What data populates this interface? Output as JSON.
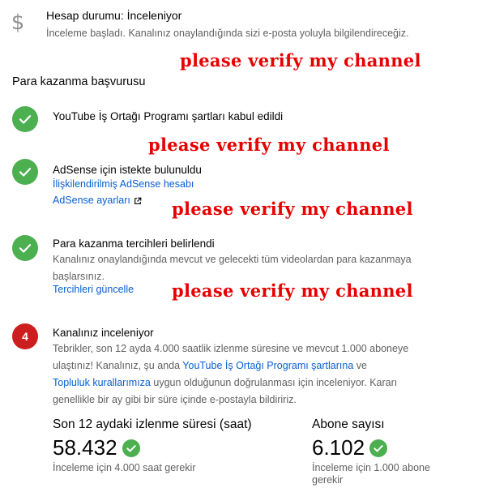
{
  "status": {
    "icon": "dollar-icon",
    "title": "Hesap durumu: İnceleniyor",
    "subtitle": "İnceleme başladı. Kanalınız onaylandığında sizi e-posta yoluyla bilgilendireceğiz."
  },
  "annotations": {
    "text": "please verify my channel",
    "color": "#e60000"
  },
  "section": {
    "title": "Para kazanma başvurusu"
  },
  "steps": [
    {
      "state": "done",
      "icon": "check-circle-icon",
      "title": "YouTube İş Ortağı Programı şartları kabul edildi"
    },
    {
      "state": "done",
      "icon": "check-circle-icon",
      "title": "AdSense için istekte bulunuldu",
      "link_linked_account": "İlişkilendirilmiş AdSense hesabı",
      "link_settings": "AdSense ayarları"
    },
    {
      "state": "done",
      "icon": "check-circle-icon",
      "title": "Para kazanma tercihleri belirlendi",
      "text": "Kanalınız onaylandığında mevcut ve gelecekti tüm videolardan para kazanmaya başlarsınız.",
      "link": "Tercihleri güncelle"
    },
    {
      "state": "pending",
      "number": "4",
      "title": "Kanalınız inceleniyor",
      "text_part1": "Tebrikler, son 12 ayda 4.000 saatlik izlenme süresine ve mevcut 1.000 aboneye ulaştınız! Kanalınız, şu anda ",
      "link1": "YouTube İş Ortağı Programı şartlarına",
      "text_part2": " ve ",
      "link2": "Topluluk kurallarımıza",
      "text_part3": " uygun olduğunun doğrulanması için inceleniyor. Kararı genellikle bir ay gibi bir süre içinde e-postayla bildiririz."
    }
  ],
  "stats": {
    "watch_time": {
      "label": "Son 12 aydaki izlenme süresi (saat)",
      "value": "58.432",
      "note": "İnceleme için 4.000 saat gerekir"
    },
    "subscribers": {
      "label": "Abone sayısı",
      "value": "6.102",
      "note": "İnceleme için 1.000 abone gerekir"
    }
  },
  "colors": {
    "success": "#4caf50",
    "pending": "#cc1e1e",
    "link": "#065fd4",
    "annotation": "#e60000"
  }
}
